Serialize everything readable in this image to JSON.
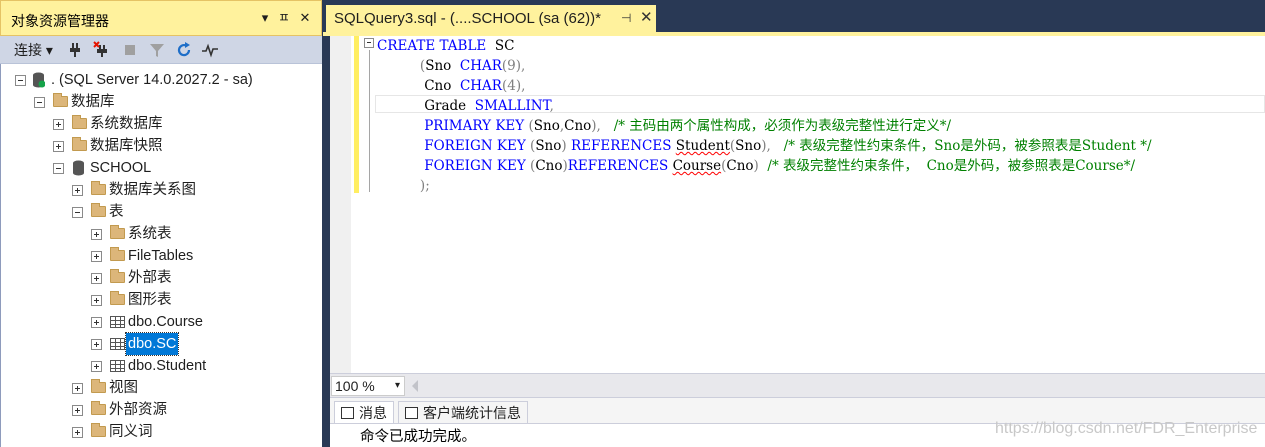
{
  "object_explorer": {
    "title": "对象资源管理器",
    "title_buttons": [
      "▾",
      "ㅍ",
      "✕"
    ],
    "toolbar": {
      "connect_label": "连接 ▾"
    },
    "tree": [
      {
        "label": ". (SQL Server 14.0.2027.2 - sa)",
        "icon": "server-db-icon",
        "state": "expanded"
      },
      {
        "label": "数据库",
        "icon": "folder-icon",
        "state": "expanded"
      },
      {
        "label": "系统数据库",
        "icon": "folder-icon",
        "state": "collapsed"
      },
      {
        "label": "数据库快照",
        "icon": "folder-icon",
        "state": "collapsed"
      },
      {
        "label": "SCHOOL",
        "icon": "database-icon",
        "state": "expanded"
      },
      {
        "label": "数据库关系图",
        "icon": "folder-icon",
        "state": "collapsed"
      },
      {
        "label": "表",
        "icon": "folder-icon",
        "state": "expanded"
      },
      {
        "label": "系统表",
        "icon": "folder-icon",
        "state": "collapsed"
      },
      {
        "label": "FileTables",
        "icon": "folder-icon",
        "state": "collapsed"
      },
      {
        "label": "外部表",
        "icon": "folder-icon",
        "state": "collapsed"
      },
      {
        "label": "图形表",
        "icon": "folder-icon",
        "state": "collapsed"
      },
      {
        "label": "dbo.Course",
        "icon": "table-icon",
        "state": "collapsed"
      },
      {
        "label": "dbo.SC",
        "icon": "table-icon",
        "state": "collapsed",
        "selected": true
      },
      {
        "label": "dbo.Student",
        "icon": "table-icon",
        "state": "collapsed"
      },
      {
        "label": "视图",
        "icon": "folder-icon",
        "state": "collapsed"
      },
      {
        "label": "外部资源",
        "icon": "folder-icon",
        "state": "collapsed"
      },
      {
        "label": "同义词",
        "icon": "folder-icon",
        "state": "collapsed"
      }
    ]
  },
  "editor": {
    "tab_title": "SQLQuery3.sql - (....SCHOOL (sa (62))*",
    "tab_pin": "⊣",
    "tab_close": "✕",
    "lines": [
      {
        "indent": "",
        "parts": [
          {
            "t": "CREATE TABLE",
            "c": "kw"
          },
          {
            "t": "  SC",
            "c": ""
          }
        ]
      },
      {
        "indent": "          ",
        "parts": [
          {
            "t": "(",
            "c": "gr"
          },
          {
            "t": "Sno  ",
            "c": ""
          },
          {
            "t": "CHAR",
            "c": "kw"
          },
          {
            "t": "(9),",
            "c": "gr"
          }
        ]
      },
      {
        "indent": "           ",
        "parts": [
          {
            "t": "Cno  ",
            "c": ""
          },
          {
            "t": "CHAR",
            "c": "kw"
          },
          {
            "t": "(4),",
            "c": "gr"
          }
        ]
      },
      {
        "indent": "           ",
        "parts": [
          {
            "t": "Grade  ",
            "c": ""
          },
          {
            "t": "SMALLINT",
            "c": "kw"
          },
          {
            "t": ",",
            "c": "gr"
          }
        ]
      },
      {
        "indent": "           ",
        "parts": [
          {
            "t": "PRIMARY KEY",
            "c": "kw"
          },
          {
            "t": " (",
            "c": "gr"
          },
          {
            "t": "Sno",
            "c": ""
          },
          {
            "t": ",",
            "c": "gr"
          },
          {
            "t": "Cno",
            "c": ""
          },
          {
            "t": "),",
            "c": "gr"
          },
          {
            "t": "   /* 主码由两个属性构成，必须作为表级完整性进行定义*/",
            "c": "cm"
          }
        ]
      },
      {
        "indent": "           ",
        "parts": [
          {
            "t": "FOREIGN KEY",
            "c": "kw"
          },
          {
            "t": " (",
            "c": "gr"
          },
          {
            "t": "Sno",
            "c": ""
          },
          {
            "t": ") ",
            "c": "gr"
          },
          {
            "t": "REFERENCES",
            "c": "kw"
          },
          {
            "t": " ",
            "c": ""
          },
          {
            "t": "Student",
            "c": "sq"
          },
          {
            "t": "(",
            "c": "gr"
          },
          {
            "t": "Sno",
            "c": ""
          },
          {
            "t": "),",
            "c": "gr"
          },
          {
            "t": "   /* 表级完整性约束条件，Sno是外码，被参照表是Student */",
            "c": "cm"
          }
        ]
      },
      {
        "indent": "           ",
        "parts": [
          {
            "t": "FOREIGN KEY",
            "c": "kw"
          },
          {
            "t": " (",
            "c": "gr"
          },
          {
            "t": "Cno",
            "c": ""
          },
          {
            "t": ")",
            "c": "gr"
          },
          {
            "t": "REFERENCES",
            "c": "kw"
          },
          {
            "t": " ",
            "c": ""
          },
          {
            "t": "Course",
            "c": "sq"
          },
          {
            "t": "(",
            "c": "gr"
          },
          {
            "t": "Cno",
            "c": ""
          },
          {
            "t": ")",
            "c": "gr"
          },
          {
            "t": "  /* 表级完整性约束条件，  Cno是外码，被参照表是Course*/",
            "c": "cm"
          }
        ]
      },
      {
        "indent": "          ",
        "parts": [
          {
            "t": ");",
            "c": "gr"
          }
        ]
      }
    ]
  },
  "statusbar": {
    "zoom": "100 %",
    "zoom_arrow": "▾"
  },
  "results": {
    "tabs": [
      "消息",
      "客户端统计信息"
    ],
    "message": "命令已成功完成。"
  },
  "watermark": "https://blog.csdn.net/FDR_Enterprise",
  "colors": {
    "active_tab": "#fff29d",
    "chrome": "#293955",
    "keyword": "#0000ff",
    "comment": "#008000",
    "selection": "#0078d7"
  }
}
